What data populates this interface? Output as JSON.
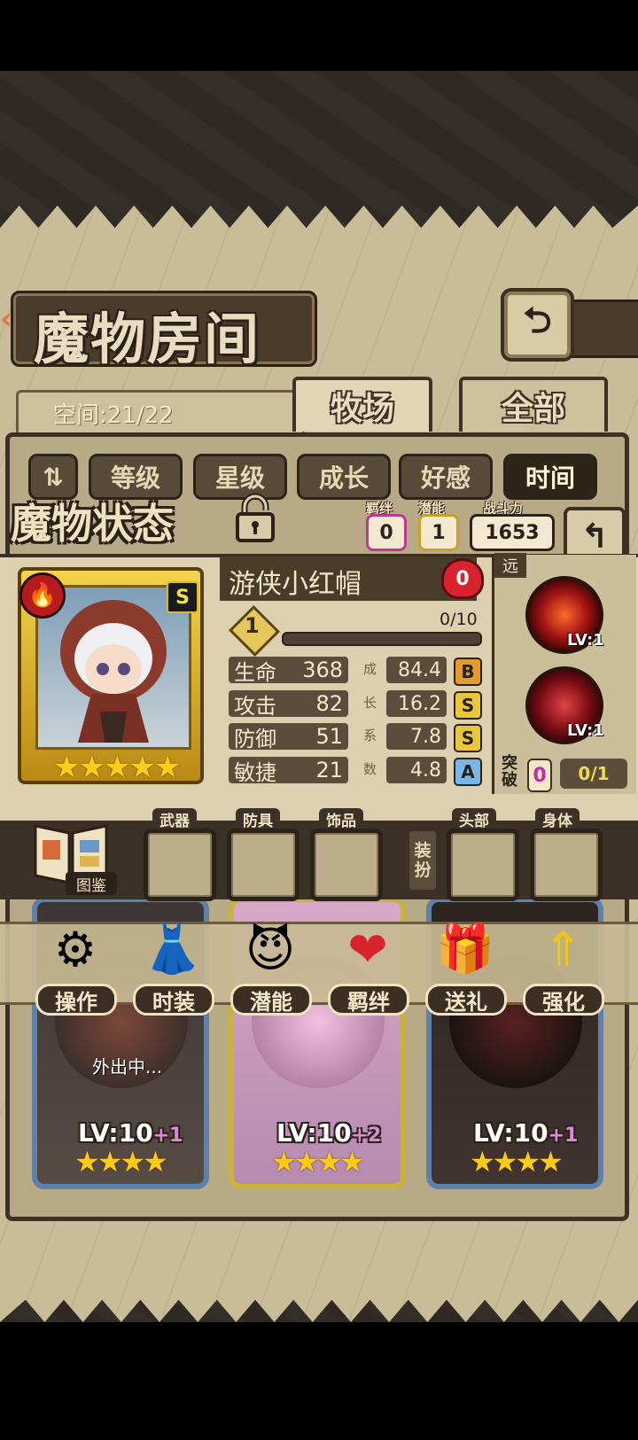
{
  "header": {
    "title": "魔物房间",
    "back_icon": "back-arrow-icon"
  },
  "space": {
    "label": "空间:21/22"
  },
  "tabs": [
    {
      "label": "牧场",
      "active": true
    },
    {
      "label": "全部",
      "active": false
    }
  ],
  "sort_buttons": [
    "等级",
    "星级",
    "成长",
    "好感",
    "时间"
  ],
  "status_panel": {
    "title": "魔物状态",
    "bond_label": "羁绊",
    "bond_value": "0",
    "potential_label": "潜能",
    "potential_value": "1",
    "power_label": "战斗力",
    "power_value": "1653",
    "monster_name": "游侠小红帽",
    "affection": "0",
    "level": "1",
    "exp": "0/10",
    "rank": "S",
    "stars": "★★★★★",
    "growth_label": [
      "成",
      "长",
      "系",
      "数"
    ],
    "stats": [
      {
        "name": "生命",
        "value": "368",
        "growth": "84.4",
        "grade": "B"
      },
      {
        "name": "攻击",
        "value": "82",
        "growth": "16.2",
        "grade": "S"
      },
      {
        "name": "防御",
        "value": "51",
        "growth": "7.8",
        "grade": "S"
      },
      {
        "name": "敏捷",
        "value": "21",
        "growth": "4.8",
        "grade": "A"
      }
    ],
    "range": "远",
    "skills": [
      {
        "level": "LV:1"
      },
      {
        "level": "LV:1"
      }
    ],
    "breakthrough_label": "突破",
    "breakthrough_count": "0",
    "breakthrough_progress": "0/1"
  },
  "equipment": {
    "codex_label": "图鉴",
    "slots": [
      "武器",
      "防具",
      "饰品",
      "头部",
      "身体"
    ],
    "dress_label": "装扮"
  },
  "actions": [
    {
      "label": "操作",
      "icon": "gear-icon"
    },
    {
      "label": "时装",
      "icon": "outfit-icon"
    },
    {
      "label": "潜能",
      "icon": "demon-icon"
    },
    {
      "label": "羁绊",
      "icon": "hearts-icon"
    },
    {
      "label": "送礼",
      "icon": "gift-icon"
    },
    {
      "label": "强化",
      "icon": "upgrade-arrows-icon"
    }
  ],
  "cards": [
    {
      "level": "LV:10",
      "plus": "+1",
      "stars": "★★★★",
      "status": "外出中..."
    },
    {
      "level": "LV:10",
      "plus": "+2",
      "stars": "★★★★",
      "status": ""
    },
    {
      "level": "LV:10",
      "plus": "+1",
      "stars": "★★★★",
      "status": ""
    }
  ],
  "colors": {
    "paper": "#c9bc99",
    "frame_dark": "#3d3125",
    "gold": "#f4d44a",
    "heart_red": "#d8232f",
    "grade_yellow": "#e8c83a",
    "grade_orange": "#e39b2e",
    "grade_blue": "#7ab7e8"
  }
}
